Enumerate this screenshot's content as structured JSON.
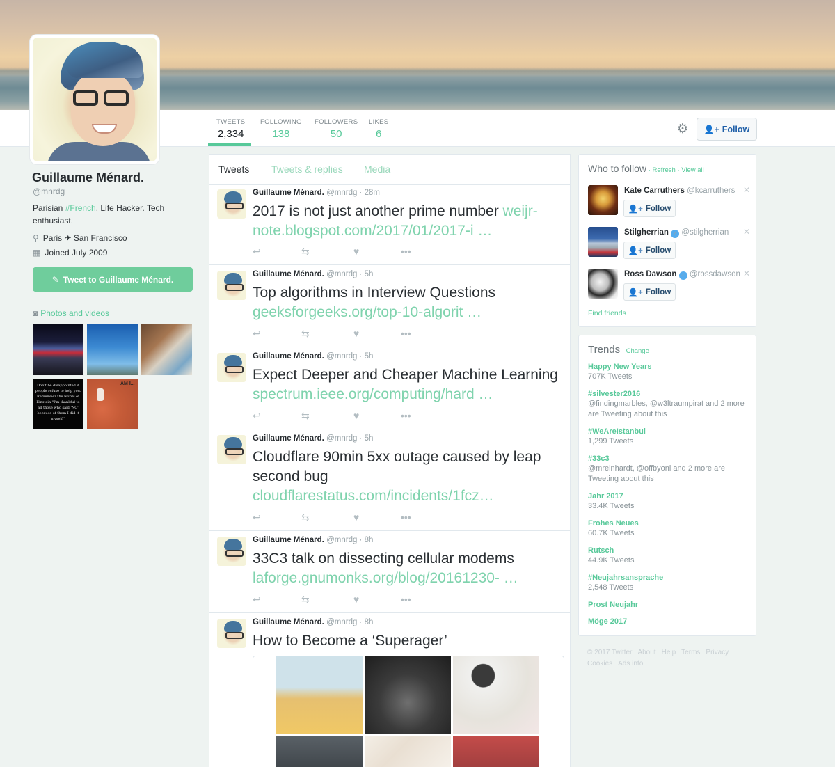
{
  "stats": [
    {
      "label": "TWEETS",
      "value": "2,334"
    },
    {
      "label": "FOLLOWING",
      "value": "138"
    },
    {
      "label": "FOLLOWERS",
      "value": "50"
    },
    {
      "label": "LIKES",
      "value": "6"
    }
  ],
  "header": {
    "follow_label": "Follow",
    "gear_icon": "gear-icon",
    "accent_color": "#58c99a"
  },
  "profile": {
    "name": "Guillaume Ménard.",
    "handle": "@mnrdg",
    "bio_before": "Parisian ",
    "bio_hashtag": "#French",
    "bio_after": ". Life Hacker. Tech enthusiast.",
    "location": "Paris ✈ San Francisco",
    "joined": "Joined July 2009",
    "tweet_to_label": "Tweet to Guillaume Ménard.",
    "photos_label": "Photos and videos",
    "thumb_text_1": "Don't be disappointed if people refuse to help you. Remember the words of Einstein \"I'm thankful to all those who said 'NO' because of them I did it myself.\"",
    "thumb_text_2": "AM I..."
  },
  "tabs": [
    "Tweets",
    "Tweets & replies",
    "Media"
  ],
  "tweets": [
    {
      "author": "Guillaume Ménard.",
      "meta": "@mnrdg · 28m",
      "text": "2017 is not just another prime number ",
      "link": "weijr-note.blogspot.com/2017/01/2017-i …"
    },
    {
      "author": "Guillaume Ménard.",
      "meta": "@mnrdg · 5h",
      "text": "Top algorithms in Interview Questions ",
      "link": "geeksforgeeks.org/top-10-algorit …"
    },
    {
      "author": "Guillaume Ménard.",
      "meta": "@mnrdg · 5h",
      "text": "Expect Deeper and Cheaper Machine Learning ",
      "link": "spectrum.ieee.org/computing/hard …"
    },
    {
      "author": "Guillaume Ménard.",
      "meta": "@mnrdg · 5h",
      "text": "Cloudflare 90min 5xx outage caused by leap second bug ",
      "link": "cloudflarestatus.com/incidents/1fcz…"
    },
    {
      "author": "Guillaume Ménard.",
      "meta": "@mnrdg · 8h",
      "text": "33C3 talk on dissecting cellular modems ",
      "link": "laforge.gnumonks.org/blog/20161230- …"
    },
    {
      "author": "Guillaume Ménard.",
      "meta": "@mnrdg · 8h",
      "text": "How to Become a ‘Superager’",
      "link": ""
    }
  ],
  "who_to_follow": {
    "title": "Who to follow",
    "refresh": "Refresh",
    "view_all": "View all",
    "follow_label": "Follow",
    "users": [
      {
        "name": "Kate Carruthers",
        "handle": "@kcarruthers",
        "verified": false
      },
      {
        "name": "Stilgherrian",
        "handle": "@stilgherrian",
        "verified": true
      },
      {
        "name": "Ross Dawson",
        "handle": "@rossdawson",
        "verified": true
      }
    ],
    "find_friends": "Find friends"
  },
  "trends": {
    "title": "Trends",
    "change": "Change",
    "items": [
      {
        "name": "Happy New Years",
        "meta": "707K Tweets"
      },
      {
        "name": "#silvester2016",
        "meta": "@findingmarbles, @w3ltraumpirat and 2 more are Tweeting about this"
      },
      {
        "name": "#WeAreIstanbul",
        "meta": "1,299 Tweets"
      },
      {
        "name": "#33c3",
        "meta": "@mreinhardt, @offbyoni and 2 more are Tweeting about this"
      },
      {
        "name": "Jahr 2017",
        "meta": "33.4K Tweets"
      },
      {
        "name": "Frohes Neues",
        "meta": "60.7K Tweets"
      },
      {
        "name": "Rutsch",
        "meta": "44.9K Tweets"
      },
      {
        "name": "#Neujahrsansprache",
        "meta": "2,548 Tweets"
      },
      {
        "name": "Prost Neujahr",
        "meta": ""
      },
      {
        "name": "Möge 2017",
        "meta": ""
      }
    ]
  },
  "footer": [
    "© 2017 Twitter",
    "About",
    "Help",
    "Terms",
    "Privacy",
    "Cookies",
    "Ads info"
  ]
}
